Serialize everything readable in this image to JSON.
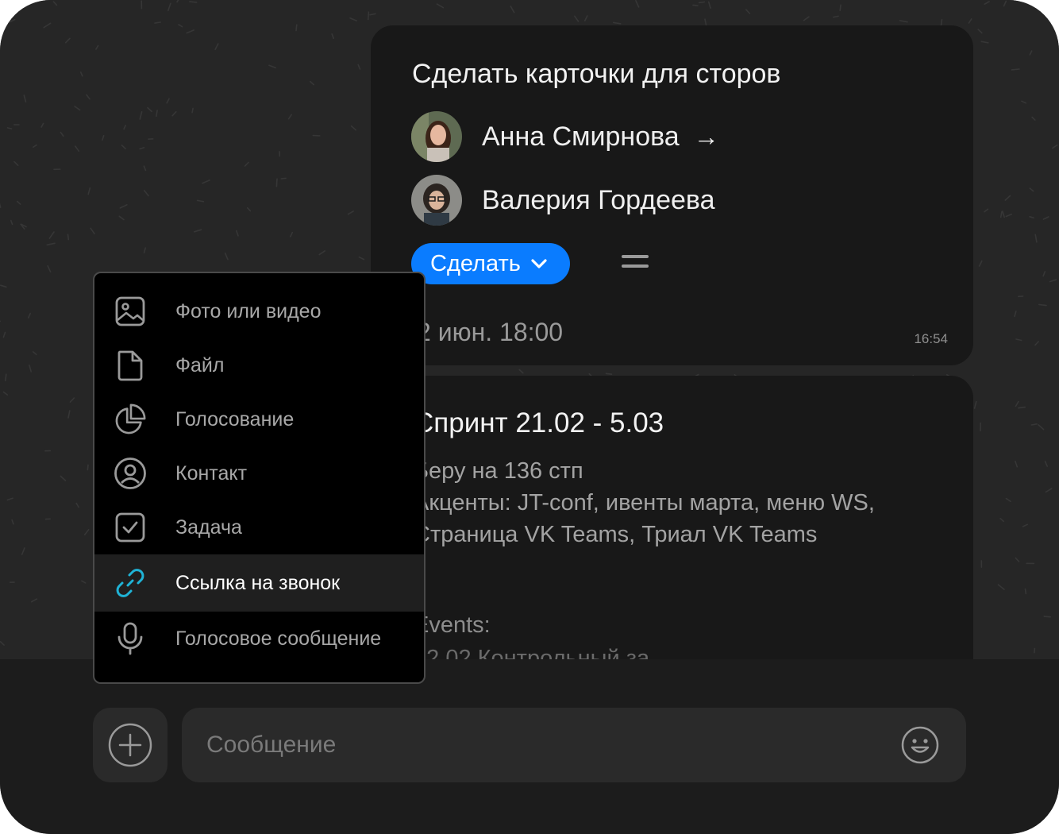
{
  "task_card": {
    "title": "Сделать карточки для сторов",
    "assignees": [
      {
        "name": "Анна Смирнова",
        "arrow": "→"
      },
      {
        "name": "Валерия Гордеева"
      }
    ],
    "action_button": "Сделать",
    "due_date": "2 июн. 18:00",
    "time": "16:54"
  },
  "sprint_card": {
    "title": "Спринт 21.02 - 5.03",
    "lines": [
      "Беру на 136 стп",
      "Акценты: JT-conf, ивенты марта, меню WS,",
      "Страница VK Teams, Триал VK Teams"
    ],
    "events_label": "Events:",
    "events_first": "22.02 Контрольный за..."
  },
  "attach_menu": {
    "items": [
      {
        "label": "Фото или видео",
        "icon": "image-icon"
      },
      {
        "label": "Файл",
        "icon": "file-icon"
      },
      {
        "label": "Голосование",
        "icon": "poll-icon"
      },
      {
        "label": "Контакт",
        "icon": "contact-icon"
      },
      {
        "label": "Задача",
        "icon": "task-icon"
      },
      {
        "label": "Ссылка на звонок",
        "icon": "call-link-icon",
        "active": true
      },
      {
        "label": "Голосовое сообщение",
        "icon": "microphone-icon"
      }
    ],
    "active_color": "#1fb3d6"
  },
  "composer": {
    "placeholder": "Сообщение"
  },
  "colors": {
    "accent": "#0a7cff",
    "background": "#232323",
    "card": "#181818"
  }
}
